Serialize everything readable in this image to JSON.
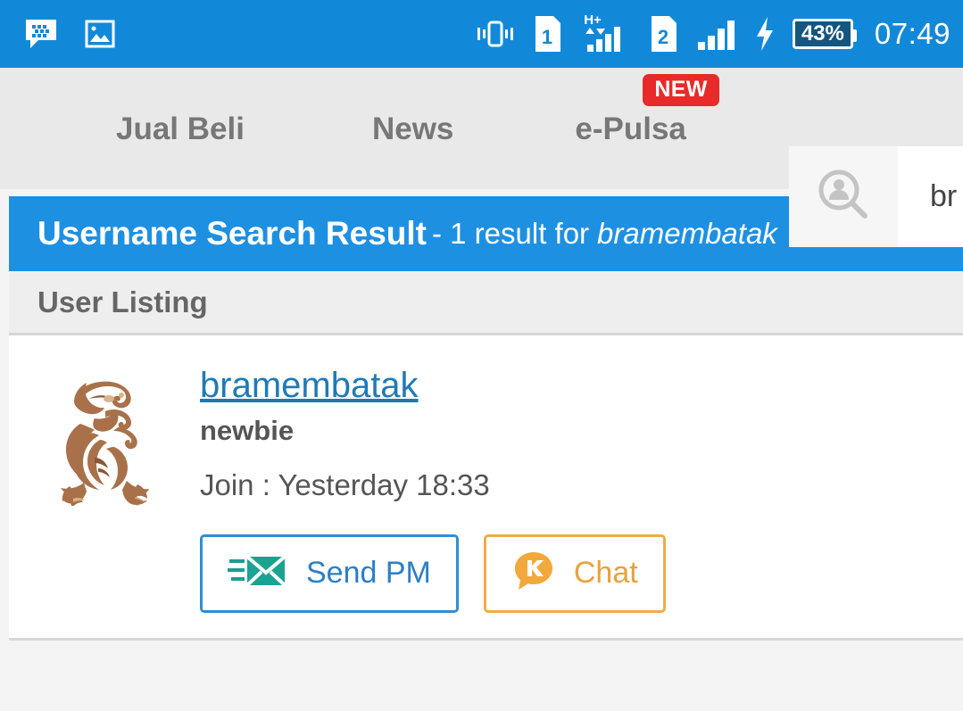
{
  "statusbar": {
    "icons_left": [
      "bbm-message-icon",
      "gallery-image-icon"
    ],
    "icons_right": [
      "vibrate-icon",
      "sim1-card-icon",
      "hplus-signal-icon",
      "sim2-card-icon",
      "signal-bars-icon",
      "charging-bolt-icon"
    ],
    "sim1_label": "1",
    "sim2_label": "2",
    "network_type": "H+",
    "battery_percent": "43%",
    "time": "07:49",
    "background_color": "#1289d8"
  },
  "tabs": [
    {
      "label": "Jual Beli",
      "badge": null
    },
    {
      "label": "News",
      "badge": null
    },
    {
      "label": "e-Pulsa",
      "badge": "NEW"
    }
  ],
  "search": {
    "icon": "user-search-icon",
    "value": "br",
    "placeholder": ""
  },
  "result_header": {
    "title": "Username Search Result",
    "separator": "- 1 result for",
    "query": "bramembatak",
    "background_color": "#1e90e2"
  },
  "section": {
    "heading": "User Listing"
  },
  "user": {
    "avatar": "dragon-statue-avatar",
    "username": "bramembatak",
    "title": "newbie",
    "join_label": "Join : Yesterday 18:33",
    "buttons": [
      {
        "label": "Send PM",
        "icon": "envelope-send-icon",
        "color": "#2d7fc4"
      },
      {
        "label": "Chat",
        "icon": "kaskus-chat-bubble-icon",
        "color": "#e8a23c"
      }
    ]
  }
}
